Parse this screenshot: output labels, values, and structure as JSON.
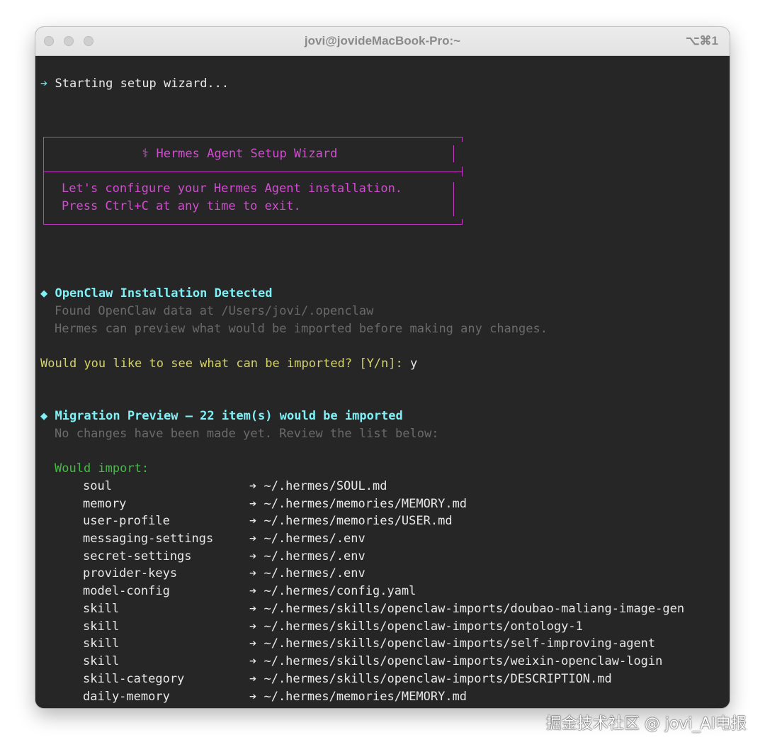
{
  "window": {
    "title": "jovi@jovideMacBook-Pro:~",
    "shortcut": "⌥⌘1"
  },
  "terminal": {
    "starting": {
      "prefix": "➔",
      "text": "Starting setup wizard..."
    },
    "wizard_box": {
      "title": "⚕ Hermes Agent Setup Wizard",
      "line1": "Let's configure your Hermes Agent installation.",
      "line2": "Press Ctrl+C at any time to exit."
    },
    "openclaw": {
      "heading": "◆ OpenClaw Installation Detected",
      "found": "Found OpenClaw data at /Users/jovi/.openclaw",
      "preview_note": "Hermes can preview what would be imported before making any changes."
    },
    "prompt": {
      "question": "Would you like to see what can be imported? [Y/n]:",
      "answer": "y"
    },
    "migration": {
      "heading": "◆ Migration Preview — 22 item(s) would be imported",
      "note": "No changes have been made yet. Review the list below:",
      "would_import_label": "Would import:",
      "items": [
        {
          "name": "soul",
          "target": "➔ ~/.hermes/SOUL.md"
        },
        {
          "name": "memory",
          "target": "➔ ~/.hermes/memories/MEMORY.md"
        },
        {
          "name": "user-profile",
          "target": "➔ ~/.hermes/memories/USER.md"
        },
        {
          "name": "messaging-settings",
          "target": "➔ ~/.hermes/.env"
        },
        {
          "name": "secret-settings",
          "target": "➔ ~/.hermes/.env"
        },
        {
          "name": "provider-keys",
          "target": "➔ ~/.hermes/.env"
        },
        {
          "name": "model-config",
          "target": "➔ ~/.hermes/config.yaml"
        },
        {
          "name": "skill",
          "target": "➔ ~/.hermes/skills/openclaw-imports/doubao-maliang-image-gen"
        },
        {
          "name": "skill",
          "target": "➔ ~/.hermes/skills/openclaw-imports/ontology-1"
        },
        {
          "name": "skill",
          "target": "➔ ~/.hermes/skills/openclaw-imports/self-improving-agent"
        },
        {
          "name": "skill",
          "target": "➔ ~/.hermes/skills/openclaw-imports/weixin-openclaw-login"
        },
        {
          "name": "skill-category",
          "target": "➔ ~/.hermes/skills/openclaw-imports/DESCRIPTION.md"
        },
        {
          "name": "daily-memory",
          "target": "➔ ~/.hermes/memories/MEMORY.md"
        }
      ]
    }
  },
  "watermark": "掘金技术社区 @ jovi_AI电报",
  "colors": {
    "terminal_bg": "#262626",
    "cyan": "#5fdde5",
    "magenta": "#d14dd0",
    "yellow": "#d6d26a",
    "green": "#3ec03e",
    "dim": "#6a6a6a"
  }
}
